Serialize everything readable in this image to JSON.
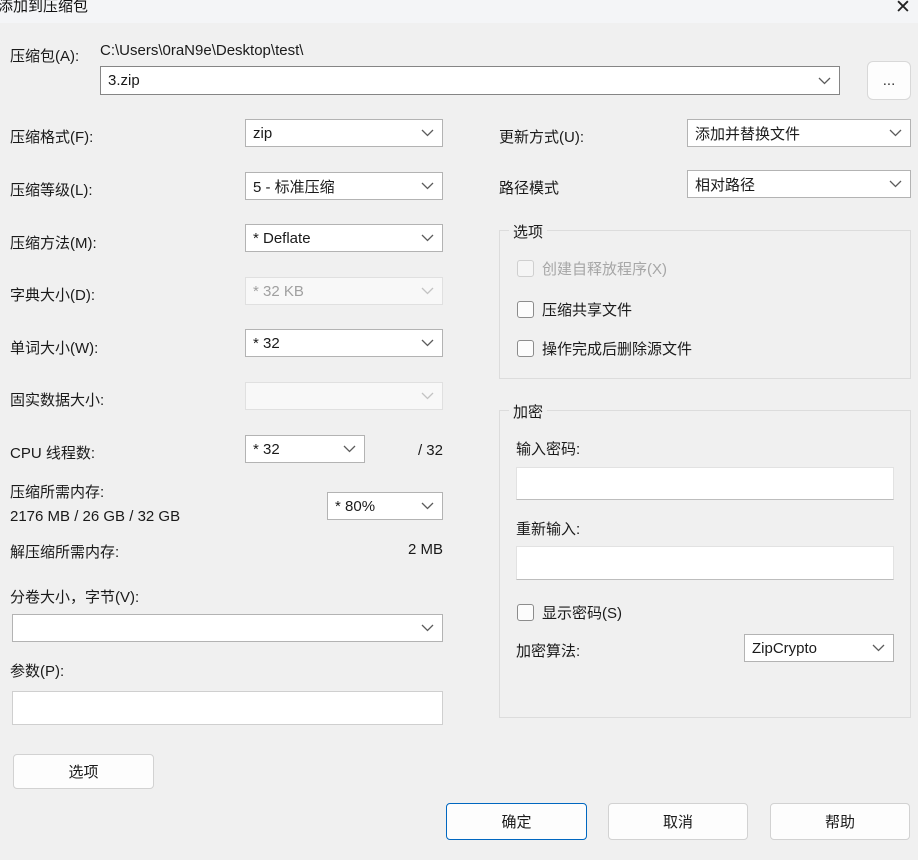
{
  "window": {
    "title": "添加到压缩包",
    "close_icon": "✕"
  },
  "archive": {
    "label": "压缩包(A):",
    "path": "C:\\Users\\0raN9e\\Desktop\\test\\",
    "name": "3.zip",
    "browse_label": "..."
  },
  "fields": {
    "format": {
      "label": "压缩格式(F):",
      "value": "zip"
    },
    "level": {
      "label": "压缩等级(L):",
      "value": "5 - 标准压缩"
    },
    "method": {
      "label": "压缩方法(M):",
      "value": "* Deflate"
    },
    "dictionary": {
      "label": "字典大小(D):",
      "value": "* 32 KB"
    },
    "word": {
      "label": "单词大小(W):",
      "value": "* 32"
    },
    "solid": {
      "label": "固实数据大小:",
      "value": ""
    },
    "cpu": {
      "label": "CPU 线程数:",
      "value": "* 32",
      "suffix": "/ 32"
    },
    "mem_compress": {
      "label": "压缩所需内存:",
      "detail": "2176 MB / 26 GB / 32 GB",
      "value": "* 80%"
    },
    "mem_decompress": {
      "label": "解压缩所需内存:",
      "value": "2 MB"
    },
    "volume": {
      "label": "分卷大小，字节(V):",
      "value": ""
    },
    "params": {
      "label": "参数(P):",
      "value": ""
    }
  },
  "right_fields": {
    "update": {
      "label": "更新方式(U):",
      "value": "添加并替换文件"
    },
    "path_mode": {
      "label": "路径模式",
      "value": "相对路径"
    }
  },
  "options_group": {
    "title": "选项",
    "items": [
      {
        "label": "创建自释放程序(X)",
        "disabled": true,
        "checked": false
      },
      {
        "label": "压缩共享文件",
        "disabled": false,
        "checked": false
      },
      {
        "label": "操作完成后删除源文件",
        "disabled": false,
        "checked": false
      }
    ]
  },
  "encryption_group": {
    "title": "加密",
    "password_label": "输入密码:",
    "password_value": "",
    "reenter_label": "重新输入:",
    "reenter_value": "",
    "show_password_label": "显示密码(S)",
    "method_label": "加密算法:",
    "method_value": "ZipCrypto"
  },
  "buttons": {
    "options": "选项",
    "ok": "确定",
    "cancel": "取消",
    "help": "帮助"
  },
  "colors": {
    "accent_blue": "#0067c0",
    "dialog_bg": "#f0f0f0",
    "titlebar_bg": "#f4f5f7"
  }
}
